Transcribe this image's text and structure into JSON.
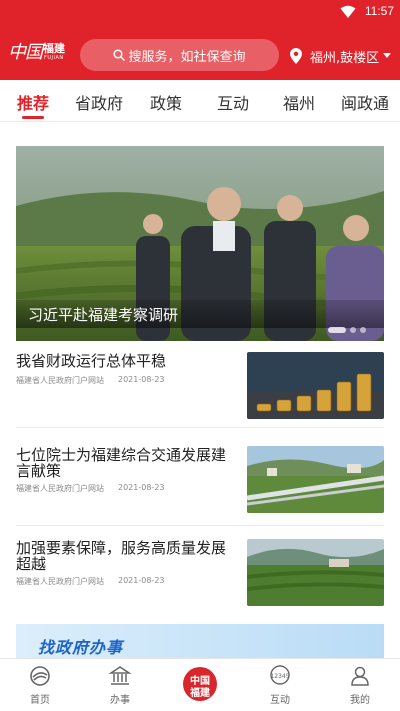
{
  "status_bar": {
    "time": "11:57"
  },
  "header": {
    "logo": {
      "main": "中国",
      "side": "福建",
      "sub": "FUJIAN"
    },
    "search_placeholder": "搜服务，如社保查询",
    "location": "福州,鼓楼区"
  },
  "tabs": [
    "推荐",
    "省政府",
    "政策",
    "互动",
    "福州",
    "闽政通"
  ],
  "active_tab": "推荐",
  "banner": {
    "caption": "习近平赴福建考察调研",
    "slide_count": 3,
    "active_slide": 1
  },
  "news": [
    {
      "title": "我省财政运行总体平稳",
      "source": "福建省人民政府门户网站",
      "date": "2021-08-23"
    },
    {
      "title": "七位院士为福建综合交通发展建言献策",
      "source": "福建省人民政府门户网站",
      "date": "2021-08-23"
    },
    {
      "title": "加强要素保障，服务高质量发展超越",
      "source": "福建省人民政府门户网站",
      "date": "2021-08-23"
    }
  ],
  "promo": {
    "text": "找政府办事"
  },
  "bottom_nav": {
    "items": [
      "首页",
      "办事",
      "互动",
      "我的"
    ],
    "center_logo": [
      "中国",
      "福建"
    ],
    "badge_12345": "12345"
  },
  "colors": {
    "brand_red": "#e0232a",
    "text_dark": "#222222",
    "text_muted": "#8a8a8a"
  }
}
